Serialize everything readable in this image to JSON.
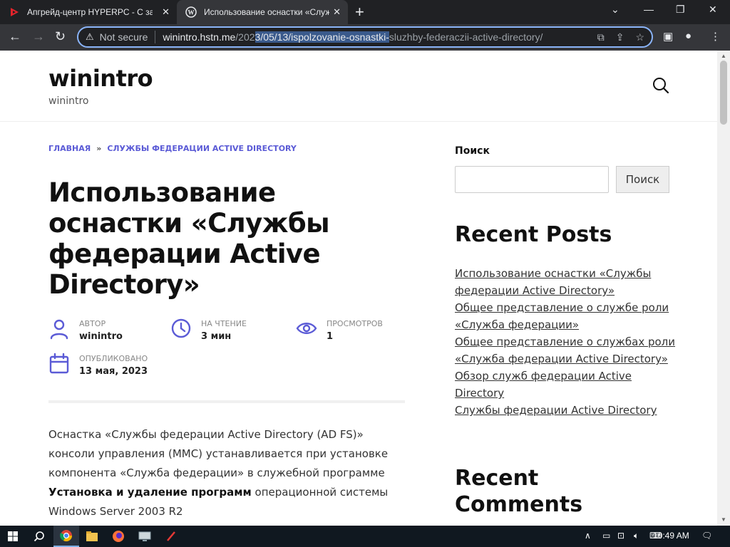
{
  "browser": {
    "tabs": [
      {
        "title": "Апгрейд-центр HYPERPC - С заб",
        "active": false
      },
      {
        "title": "Использование оснастки «Служ",
        "active": true
      }
    ],
    "security_label": "Not secure",
    "url_host": "winintro.hstn.me",
    "url_path_pre": "/202",
    "url_path_selected": "3/05/13/ispolzovanie-osnastki-",
    "url_path_post": "sluzhby-federaczii-active-directory/"
  },
  "site": {
    "title": "winintro",
    "description": "winintro"
  },
  "breadcrumb": {
    "home": "ГЛАВНАЯ",
    "separator": "»",
    "category": "СЛУЖБЫ ФЕДЕРАЦИИ ACTIVE DIRECTORY"
  },
  "post": {
    "title": "Использование оснастки «Службы федерации Active Directory»",
    "meta": {
      "author_label": "АВТОР",
      "author": "winintro",
      "read_label": "НА ЧТЕНИЕ",
      "read_time": "3 мин",
      "views_label": "ПРОСМОТРОВ",
      "views": "1",
      "published_label": "ОПУБЛИКОВАНО",
      "published": "13 мая, 2023"
    },
    "body_1": "Оснастка «Службы федерации Active Directory (AD FS)» консоли управления (MMC) устанавливается при установке компонента «Служба федерации» в служебной программе ",
    "body_bold": "Установка и удаление программ",
    "body_2": " операционной системы Windows Server 2003 R2"
  },
  "sidebar": {
    "search_label": "Поиск",
    "search_button": "Поиск",
    "recent_posts_title": "Recent Posts",
    "recent_posts": [
      "Использование оснастки «Службы федерации Active Directory»",
      "Общее представление о службе роли «Служба федерации»",
      "Общее представление о службах роли «Служба федерации Active Directory»",
      "Обзор служб федерации Active Directory",
      "Службы федерации Active Directory"
    ],
    "recent_comments_title": "Recent Comments"
  },
  "taskbar": {
    "clock": "10:49 AM"
  },
  "colors": {
    "accent": "#5b5bd6",
    "chrome_dark": "#202124",
    "chrome_toolbar": "#35363a",
    "omnibox_focus": "#8ab4f8"
  }
}
